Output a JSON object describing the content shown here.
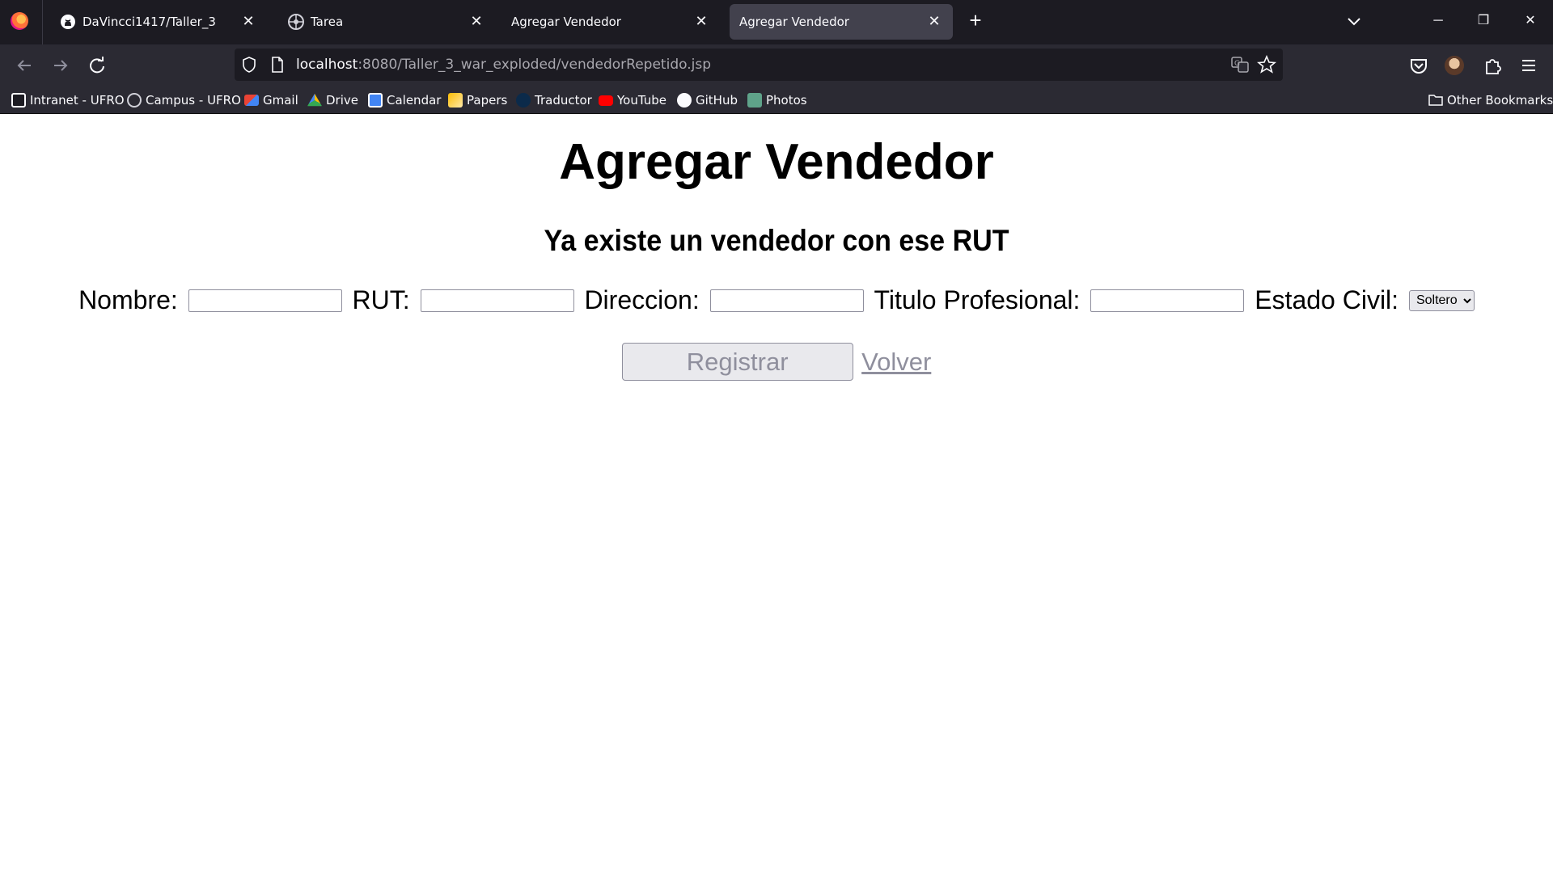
{
  "browser": {
    "tabs": [
      {
        "label": "DaVincci1417/Taller_3",
        "icon": "github-icon",
        "active": false
      },
      {
        "label": "Tarea",
        "icon": "campus-icon",
        "active": false
      },
      {
        "label": "Agregar Vendedor",
        "icon": "",
        "active": false
      },
      {
        "label": "Agregar Vendedor",
        "icon": "",
        "active": true
      }
    ],
    "url_host": "localhost",
    "url_path": ":8080/Taller_3_war_exploded/vendedorRepetido.jsp",
    "bookmarks": [
      {
        "label": "Intranet - UFRO",
        "icon": "intranet-icon"
      },
      {
        "label": "Campus - UFRO",
        "icon": "campus-icon"
      },
      {
        "label": "Gmail",
        "icon": "gmail-icon"
      },
      {
        "label": "Drive",
        "icon": "drive-icon"
      },
      {
        "label": "Calendar",
        "icon": "calendar-icon"
      },
      {
        "label": "Papers",
        "icon": "papers-icon"
      },
      {
        "label": "Traductor",
        "icon": "translate-icon"
      },
      {
        "label": "YouTube",
        "icon": "youtube-icon"
      },
      {
        "label": "GitHub",
        "icon": "github-icon"
      },
      {
        "label": "Photos",
        "icon": "photos-icon"
      }
    ],
    "other_bookmarks": "Other Bookmarks",
    "colors": {
      "tabstrip": "#1c1b22",
      "toolbar": "#2b2a33",
      "active_tab": "#42414d"
    }
  },
  "page": {
    "title": "Agregar Vendedor",
    "error": "Ya existe un vendedor con ese RUT",
    "form": {
      "nombre_label": "Nombre:",
      "rut_label": "RUT:",
      "direccion_label": "Direccion:",
      "titulo_label": "Titulo Profesional:",
      "estado_label": "Estado Civil:",
      "estado_selected": "Soltero",
      "nombre_value": "",
      "rut_value": "",
      "direccion_value": "",
      "titulo_value": ""
    },
    "actions": {
      "registrar_label": "Registrar",
      "volver_label": "Volver"
    }
  }
}
